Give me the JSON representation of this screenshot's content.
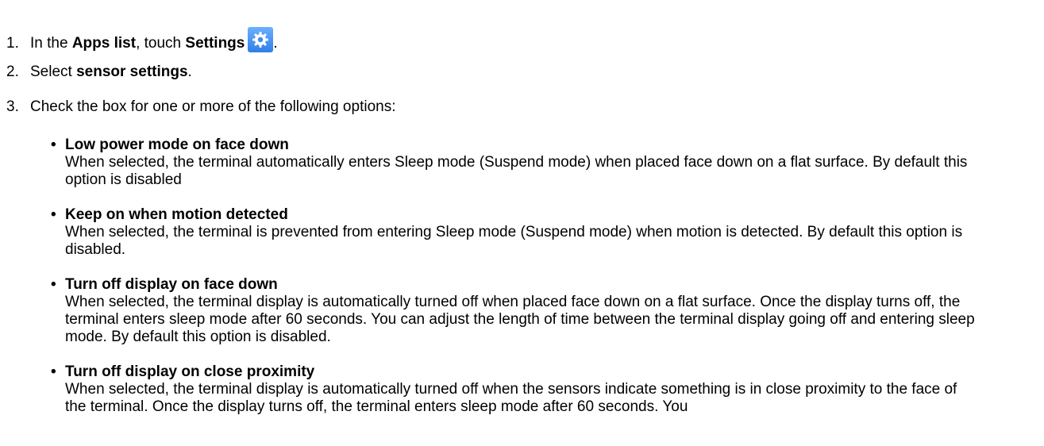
{
  "steps": [
    {
      "number": "1.",
      "text_1": "In the ",
      "bold_1": "Apps list",
      "text_2": ", touch ",
      "bold_2": "Settings",
      "icon": "gear-icon",
      "text_3": "."
    },
    {
      "number": "2.",
      "text_1": "Select ",
      "bold_1": "sensor settings",
      "text_2": "."
    },
    {
      "number": "3.",
      "text": "Check the box for one or more of the following options:"
    }
  ],
  "options": [
    {
      "bullet": "•",
      "title": "Low power mode on face down",
      "description": "When selected, the terminal automatically enters Sleep mode (Suspend mode) when placed face down on a flat surface. By default this option is disabled"
    },
    {
      "bullet": "•",
      "title": "Keep on when motion detected",
      "description": "When selected, the terminal is prevented from entering Sleep mode (Suspend mode) when motion is detected. By default this option is disabled."
    },
    {
      "bullet": "•",
      "title": "Turn off display on face down",
      "description": "When selected, the terminal display is automatically turned off when placed face down on a flat surface. Once the display turns off, the terminal enters sleep mode after 60 seconds. You can adjust the length of time between the terminal display going off and entering sleep mode. By default this option is disabled."
    },
    {
      "bullet": "•",
      "title": "Turn off display on close proximity",
      "description": "When selected, the terminal display is automatically turned off when the sensors indicate something is in close proximity to the face of the terminal. Once the display turns off, the terminal enters sleep mode after 60 seconds. You"
    }
  ],
  "colors": {
    "icon_top": "#6bb0ff",
    "icon_bottom": "#2f7fe6",
    "text": "#000000"
  }
}
